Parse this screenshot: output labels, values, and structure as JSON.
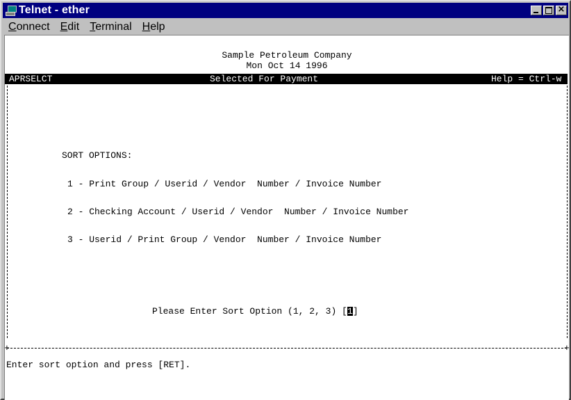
{
  "window": {
    "title": "Telnet - ether",
    "icon": "telnet-monitor-icon"
  },
  "menu": {
    "items": [
      {
        "label_u": "C",
        "label_rest": "onnect"
      },
      {
        "label_u": "E",
        "label_rest": "dit"
      },
      {
        "label_u": "T",
        "label_rest": "erminal"
      },
      {
        "label_u": "H",
        "label_rest": "elp"
      }
    ]
  },
  "screen": {
    "company": "Sample Petroleum Company",
    "date": "Mon Oct 14 1996",
    "program_id": "APRSELCT",
    "screen_title": "Selected For Payment",
    "help_hint": "Help = Ctrl-w",
    "sort_heading": "SORT OPTIONS:",
    "options": [
      "1 - Print Group / Userid / Vendor  Number / Invoice Number",
      "2 - Checking Account / Userid / Vendor  Number / Invoice Number",
      "3 - Userid / Print Group / Vendor  Number / Invoice Number"
    ],
    "prompt": "Please Enter Sort Option (1, 2, 3) [",
    "prompt_close": "]",
    "prompt_value": "1",
    "status_line": "Enter sort option and press [RET]."
  }
}
